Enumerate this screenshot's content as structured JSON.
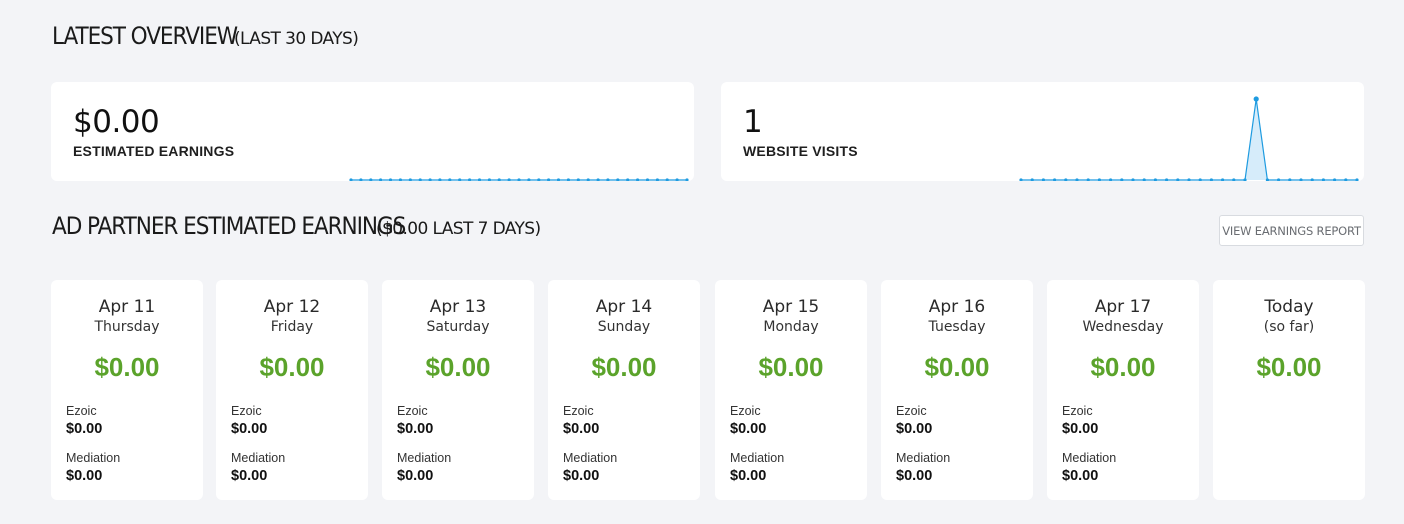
{
  "latest_overview": {
    "title": "LATEST OVERVIEW",
    "period": "(LAST 30 DAYS)",
    "earnings": {
      "value": "$0.00",
      "label": "ESTIMATED EARNINGS"
    },
    "visits": {
      "value": "1",
      "label": "WEBSITE VISITS"
    }
  },
  "ad_partner": {
    "title": "AD PARTNER ESTIMATED EARNINGS",
    "subtitle": "($0.00 LAST 7 DAYS)",
    "report_button": "VIEW EARNINGS REPORT",
    "days": [
      {
        "date": "Apr 11",
        "weekday": "Thursday",
        "total": "$0.00",
        "ezoic_label": "Ezoic",
        "ezoic": "$0.00",
        "mediation_label": "Mediation",
        "mediation": "$0.00"
      },
      {
        "date": "Apr 12",
        "weekday": "Friday",
        "total": "$0.00",
        "ezoic_label": "Ezoic",
        "ezoic": "$0.00",
        "mediation_label": "Mediation",
        "mediation": "$0.00"
      },
      {
        "date": "Apr 13",
        "weekday": "Saturday",
        "total": "$0.00",
        "ezoic_label": "Ezoic",
        "ezoic": "$0.00",
        "mediation_label": "Mediation",
        "mediation": "$0.00"
      },
      {
        "date": "Apr 14",
        "weekday": "Sunday",
        "total": "$0.00",
        "ezoic_label": "Ezoic",
        "ezoic": "$0.00",
        "mediation_label": "Mediation",
        "mediation": "$0.00"
      },
      {
        "date": "Apr 15",
        "weekday": "Monday",
        "total": "$0.00",
        "ezoic_label": "Ezoic",
        "ezoic": "$0.00",
        "mediation_label": "Mediation",
        "mediation": "$0.00"
      },
      {
        "date": "Apr 16",
        "weekday": "Tuesday",
        "total": "$0.00",
        "ezoic_label": "Ezoic",
        "ezoic": "$0.00",
        "mediation_label": "Mediation",
        "mediation": "$0.00"
      },
      {
        "date": "Apr 17",
        "weekday": "Wednesday",
        "total": "$0.00",
        "ezoic_label": "Ezoic",
        "ezoic": "$0.00",
        "mediation_label": "Mediation",
        "mediation": "$0.00"
      }
    ],
    "today": {
      "date": "Today",
      "weekday": "(so far)",
      "total": "$0.00"
    }
  },
  "colors": {
    "accent_green": "#5ba32b",
    "sparkline_blue": "#1e9be0",
    "sparkline_fill": "#d6ecfa"
  },
  "chart_data": [
    {
      "type": "area",
      "series": [
        {
          "values": [
            0,
            0,
            0,
            0,
            0,
            0,
            0,
            0,
            0,
            0,
            0,
            0,
            0,
            0,
            0,
            0,
            0,
            0,
            0,
            0,
            0,
            0,
            0,
            0,
            0,
            0,
            0,
            0,
            0,
            0,
            0,
            0,
            0,
            0,
            0
          ]
        }
      ],
      "grid": false
    },
    {
      "type": "area",
      "series": [
        {
          "values": [
            0,
            0,
            0,
            0,
            0,
            0,
            0,
            0,
            0,
            0,
            0,
            0,
            0,
            0,
            0,
            0,
            0,
            0,
            0,
            0,
            0,
            1,
            0,
            0,
            0,
            0,
            0,
            0,
            0,
            0,
            0
          ]
        }
      ],
      "grid": false
    }
  ]
}
